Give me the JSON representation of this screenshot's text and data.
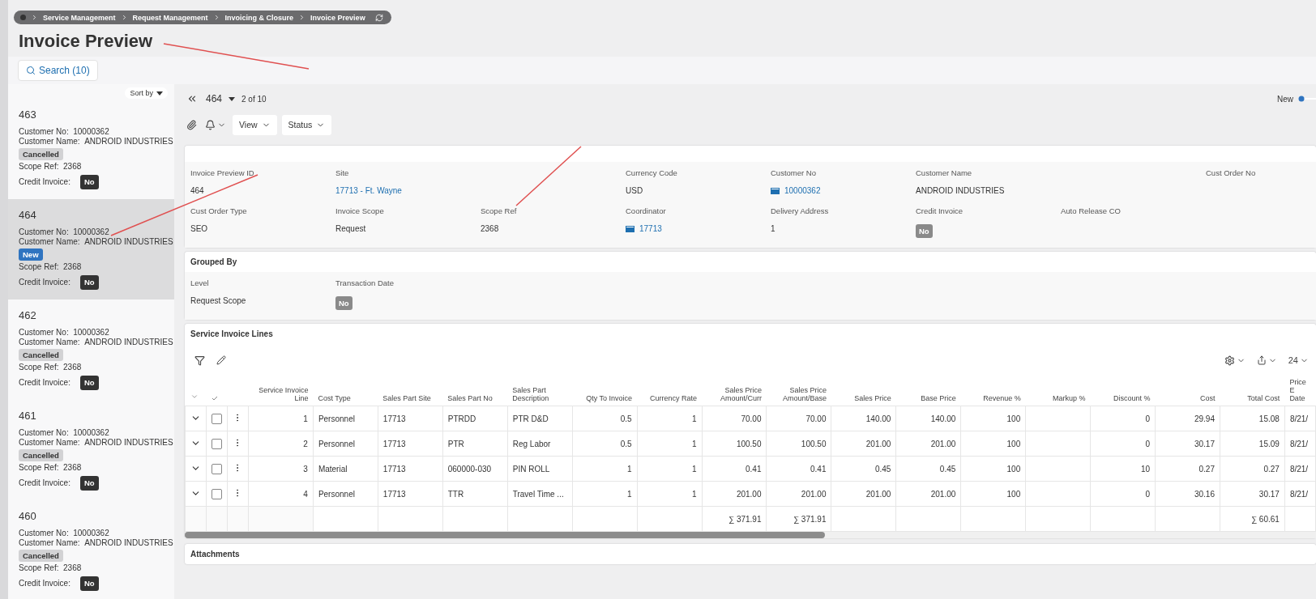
{
  "breadcrumb": [
    "Service Management",
    "Request Management",
    "Invoicing & Closure",
    "Invoice Preview"
  ],
  "page_title": "Invoice Preview",
  "search_button": "Search (10)",
  "sort_by": "Sort by",
  "records": [
    {
      "id": "463",
      "selected": false,
      "fields": [
        {
          "label": "Customer No:",
          "value": "10000362"
        },
        {
          "label": "Customer Name:",
          "value": "ANDROID INDUSTRIES"
        }
      ],
      "status": {
        "label": "Cancelled",
        "kind": "cancelled"
      },
      "scope_ref": {
        "label": "Scope Ref:",
        "value": "2368"
      },
      "credit_invoice": {
        "label": "Credit Invoice:",
        "value": "No"
      }
    },
    {
      "id": "464",
      "selected": true,
      "fields": [
        {
          "label": "Customer No:",
          "value": "10000362"
        },
        {
          "label": "Customer Name:",
          "value": "ANDROID INDUSTRIES"
        }
      ],
      "status": {
        "label": "New",
        "kind": "new"
      },
      "scope_ref": {
        "label": "Scope Ref:",
        "value": "2368"
      },
      "credit_invoice": {
        "label": "Credit Invoice:",
        "value": "No"
      }
    },
    {
      "id": "462",
      "selected": false,
      "fields": [
        {
          "label": "Customer No:",
          "value": "10000362"
        },
        {
          "label": "Customer Name:",
          "value": "ANDROID INDUSTRIES"
        }
      ],
      "status": {
        "label": "Cancelled",
        "kind": "cancelled"
      },
      "scope_ref": {
        "label": "Scope Ref:",
        "value": "2368"
      },
      "credit_invoice": {
        "label": "Credit Invoice:",
        "value": "No"
      }
    },
    {
      "id": "461",
      "selected": false,
      "fields": [
        {
          "label": "Customer No:",
          "value": "10000362"
        },
        {
          "label": "Customer Name:",
          "value": "ANDROID INDUSTRIES"
        }
      ],
      "status": {
        "label": "Cancelled",
        "kind": "cancelled"
      },
      "scope_ref": {
        "label": "Scope Ref:",
        "value": "2368"
      },
      "credit_invoice": {
        "label": "Credit Invoice:",
        "value": "No"
      }
    },
    {
      "id": "460",
      "selected": false,
      "fields": [
        {
          "label": "Customer No:",
          "value": "10000362"
        },
        {
          "label": "Customer Name:",
          "value": "ANDROID INDUSTRIES"
        }
      ],
      "status": {
        "label": "Cancelled",
        "kind": "cancelled"
      },
      "scope_ref": {
        "label": "Scope Ref:",
        "value": "2368"
      },
      "credit_invoice": {
        "label": "Credit Invoice:",
        "value": "No"
      }
    }
  ],
  "navigator": {
    "record": "464",
    "position": "2 of 10",
    "status": "New"
  },
  "toolbar": {
    "menus": [
      "View",
      "Status"
    ]
  },
  "header_fields": [
    {
      "kind": "text",
      "label": "Invoice Preview ID",
      "value": "464"
    },
    {
      "kind": "link",
      "label": "Site",
      "value": "17713 - Ft. Wayne"
    },
    {
      "kind": "blank"
    },
    {
      "kind": "text",
      "label": "Currency Code",
      "value": "USD"
    },
    {
      "kind": "icon_link",
      "label": "Customer No",
      "value": "10000362"
    },
    {
      "kind": "text",
      "label": "Customer Name",
      "value": "ANDROID INDUSTRIES"
    },
    {
      "kind": "blank"
    },
    {
      "kind": "label_only",
      "label": "Cust Order No"
    },
    {
      "kind": "text",
      "label": "Cust Order Type",
      "value": "SEO"
    },
    {
      "kind": "text",
      "label": "Invoice Scope",
      "value": "Request"
    },
    {
      "kind": "text",
      "label": "Scope Ref",
      "value": "2368"
    },
    {
      "kind": "icon_link",
      "label": "Coordinator",
      "value": "17713"
    },
    {
      "kind": "text",
      "label": "Delivery Address",
      "value": "1"
    },
    {
      "kind": "badge",
      "label": "Credit Invoice",
      "value": "No"
    },
    {
      "kind": "label_only",
      "label": "Auto Release CO"
    }
  ],
  "grouped_by": {
    "title": "Grouped By",
    "fields": [
      {
        "kind": "text",
        "label": "Level",
        "value": "Request Scope"
      },
      {
        "kind": "badge",
        "label": "Transaction Date",
        "value": "No"
      }
    ]
  },
  "lines": {
    "title": "Service Invoice Lines",
    "page_size": "24",
    "columns": [
      {
        "label": "Service Invoice Line",
        "kind": "number"
      },
      {
        "label": "Cost Type",
        "kind": "text"
      },
      {
        "label": "Sales Part Site",
        "kind": "text"
      },
      {
        "label": "Sales Part No",
        "kind": "text"
      },
      {
        "label": "Sales Part Description",
        "kind": "text"
      },
      {
        "label": "Qty To Invoice",
        "kind": "number"
      },
      {
        "label": "Currency Rate",
        "kind": "number"
      },
      {
        "label": "Sales Price Amount/Curr",
        "kind": "number",
        "total": "∑ 371.91"
      },
      {
        "label": "Sales Price Amount/Base",
        "kind": "number",
        "total": "∑ 371.91"
      },
      {
        "label": "Sales Price",
        "kind": "number"
      },
      {
        "label": "Base Price",
        "kind": "number"
      },
      {
        "label": "Revenue %",
        "kind": "number"
      },
      {
        "label": "Markup %",
        "kind": "number"
      },
      {
        "label": "Discount %",
        "kind": "number"
      },
      {
        "label": "Cost",
        "kind": "number"
      },
      {
        "label": "Total Cost",
        "kind": "number",
        "total": "∑ 60.61"
      },
      {
        "label": "Price E Date",
        "kind": "edge"
      }
    ],
    "rows": [
      {
        "checked": false,
        "cells": [
          "1",
          "Personnel",
          "17713",
          "PTRDD",
          "PTR D&D",
          "0.5",
          "1",
          "70.00",
          "70.00",
          "140.00",
          "140.00",
          "100",
          null,
          "0",
          "29.94",
          "15.08",
          "8/21/"
        ]
      },
      {
        "checked": false,
        "cells": [
          "2",
          "Personnel",
          "17713",
          "PTR",
          "Reg Labor",
          "0.5",
          "1",
          "100.50",
          "100.50",
          "201.00",
          "201.00",
          "100",
          null,
          "0",
          "30.17",
          "15.09",
          "8/21/"
        ]
      },
      {
        "checked": false,
        "cells": [
          "3",
          "Material",
          "17713",
          "060000-030",
          "PIN ROLL",
          "1",
          "1",
          "0.41",
          "0.41",
          "0.45",
          "0.45",
          "100",
          null,
          "10",
          "0.27",
          "0.27",
          "8/21/"
        ]
      },
      {
        "checked": false,
        "cells": [
          "4",
          "Personnel",
          "17713",
          "TTR",
          "Travel Time ...",
          "1",
          "1",
          "201.00",
          "201.00",
          "201.00",
          "201.00",
          "100",
          null,
          "0",
          "30.16",
          "30.17",
          "8/21/"
        ]
      }
    ]
  },
  "attachments": {
    "title": "Attachments"
  }
}
